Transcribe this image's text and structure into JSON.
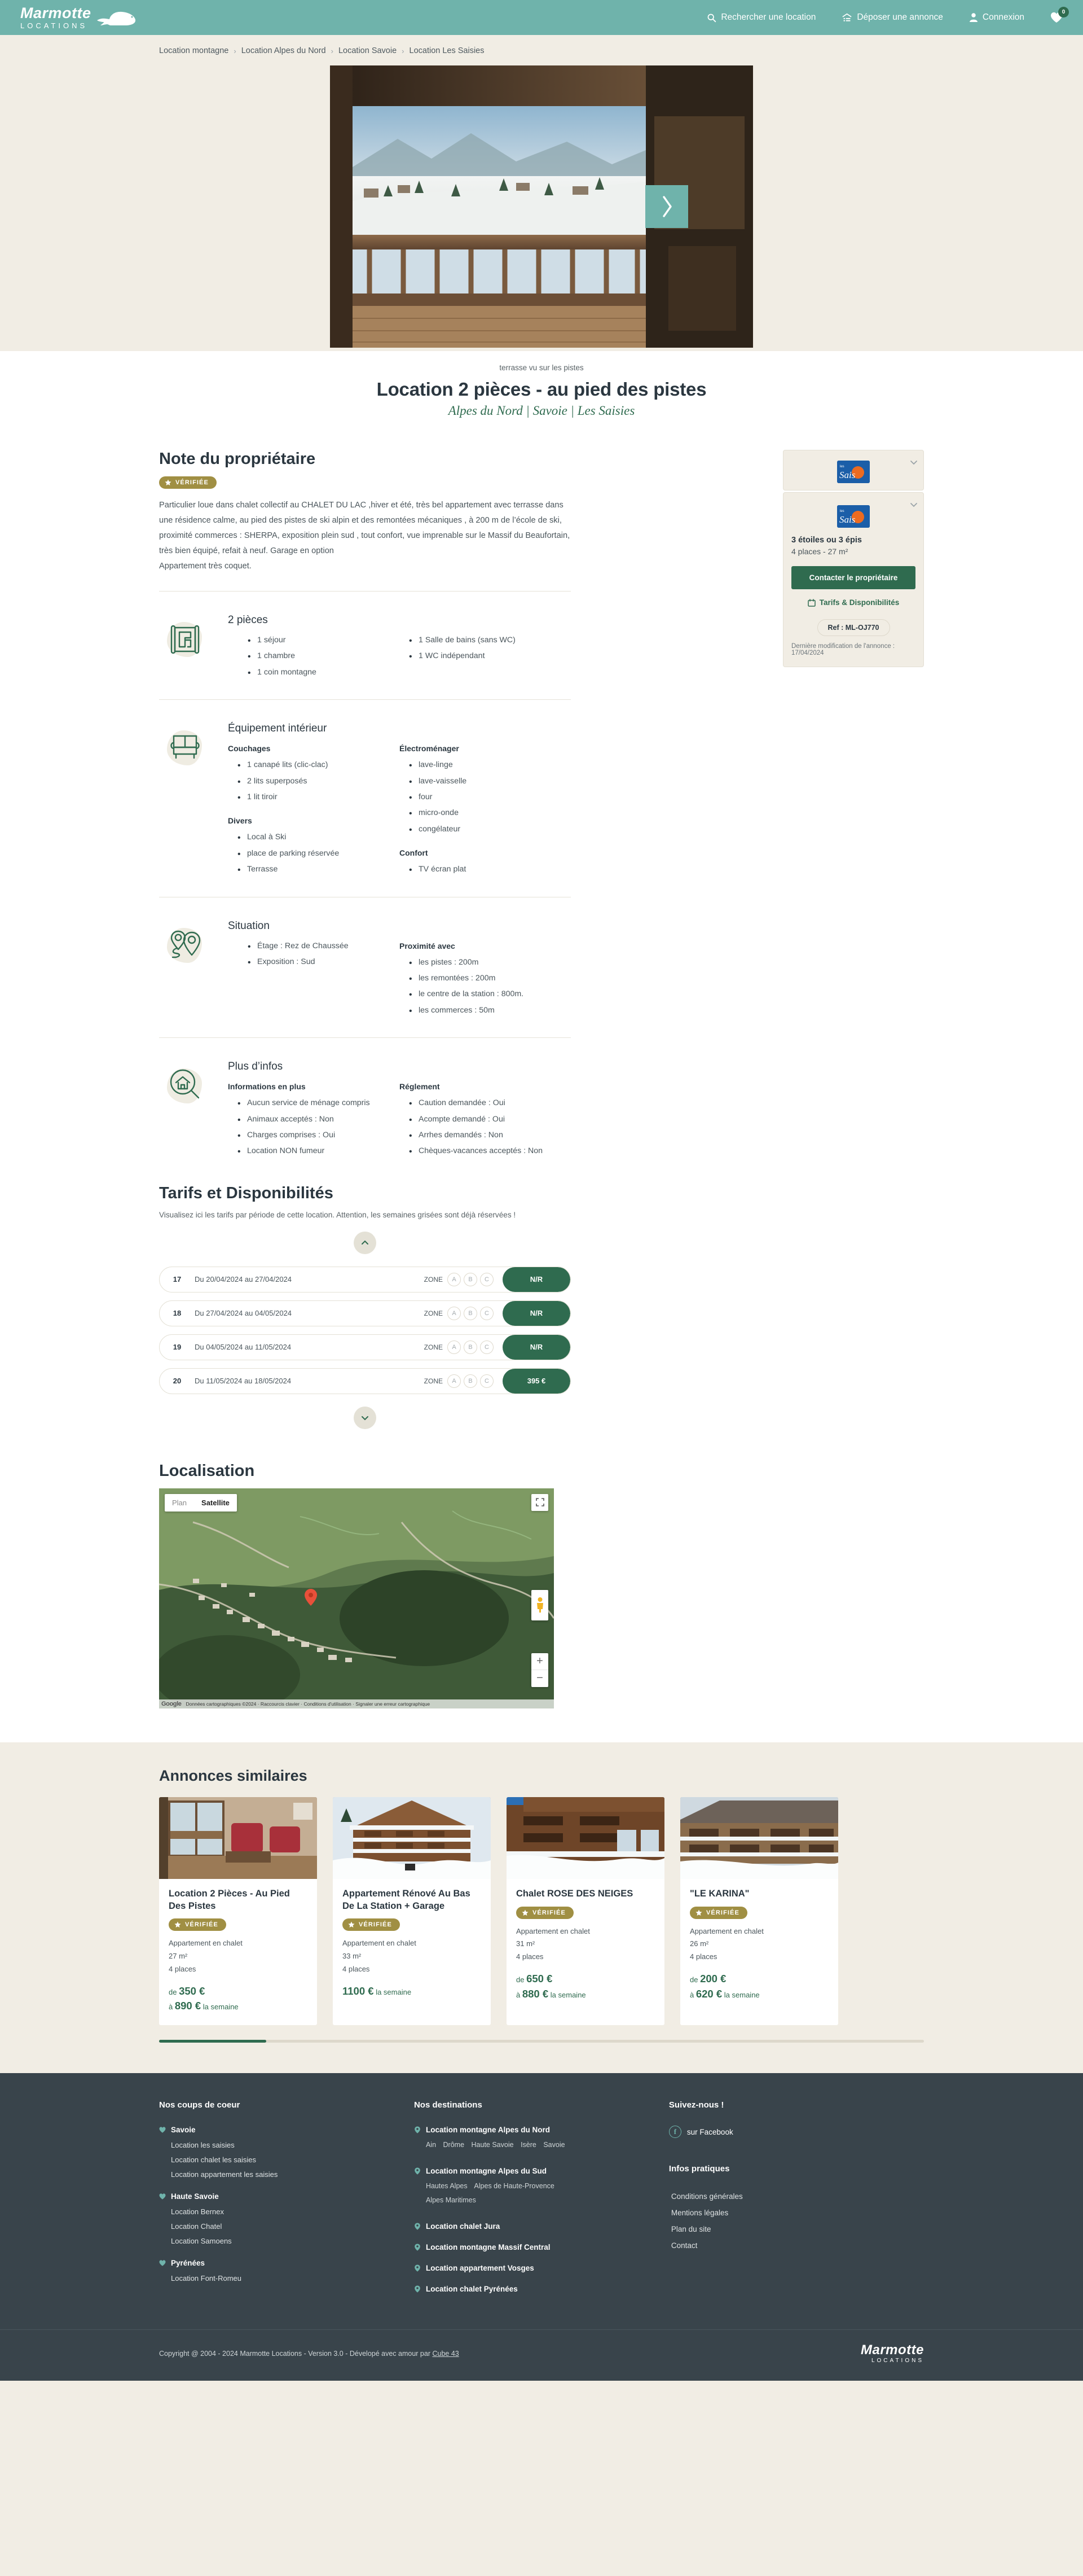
{
  "brand": {
    "name": "Marmotte",
    "sub": "LOCATIONS",
    "icon": "marmot-icon"
  },
  "header": {
    "nav": [
      {
        "label": "Rechercher une location",
        "icon": "search-icon"
      },
      {
        "label": "Déposer une annonce",
        "icon": "house-upload-icon"
      },
      {
        "label": "Connexion",
        "icon": "user-icon"
      }
    ],
    "favorites": {
      "icon": "heart-icon",
      "count": "0"
    }
  },
  "breadcrumb": [
    "Location montagne",
    "Location Alpes du Nord",
    "Location Savoie",
    "Location Les Saisies"
  ],
  "breadcrumb_separator": "›",
  "gallery": {
    "prev_icon": "chevron-left-icon",
    "next_icon": "chevron-right-icon",
    "caption": "terrasse vu sur les pistes"
  },
  "listing": {
    "title": "Location 2 pièces - au pied des pistes",
    "subtitle": "Alpes du Nord | Savoie | Les Saisies"
  },
  "note": {
    "heading": "Note du propriétaire",
    "badge": "VÉRIFIÉE",
    "badge_icon": "star-icon",
    "paragraphs": [
      "Particulier loue dans chalet collectif au CHALET DU LAC ,hiver et été, très bel appartement avec terrasse dans une résidence calme, au pied des pistes de ski alpin et des remontées mécaniques , à 200 m de l’école de ski, proximité commerces : SHERPA, exposition plein sud , tout confort, vue imprenable sur le Massif du Beaufortain, très bien équipé, refait à neuf. Garage en option",
      "Appartement très coquet."
    ]
  },
  "sections": [
    {
      "icon": "floorplan-icon",
      "heading": "2 pièces",
      "columns": [
        {
          "title": "",
          "items": [
            "1 séjour",
            "1 chambre",
            "1 coin montagne"
          ]
        },
        {
          "title": "",
          "items": [
            "1 Salle de bains (sans WC)",
            "1 WC indépendant"
          ]
        }
      ]
    },
    {
      "icon": "sofa-icon",
      "heading": "Équipement intérieur",
      "columns": [
        {
          "groups": [
            {
              "title": "Couchages",
              "items": [
                "1 canapé lits (clic-clac)",
                "2 lits superposés",
                "1 lit tiroir"
              ]
            },
            {
              "title": "Divers",
              "items": [
                "Local à Ski",
                "place de parking réservée",
                "Terrasse"
              ]
            }
          ]
        },
        {
          "groups": [
            {
              "title": "Électroménager",
              "items": [
                "lave-linge",
                "lave-vaisselle",
                "four",
                "micro-onde",
                "congélateur"
              ]
            },
            {
              "title": "Confort",
              "items": [
                "TV écran plat"
              ]
            }
          ]
        }
      ]
    },
    {
      "icon": "map-pins-icon",
      "heading": "Situation",
      "columns": [
        {
          "groups": [
            {
              "title": "",
              "items": [
                "Étage : Rez de Chaussée",
                "Exposition : Sud"
              ]
            }
          ]
        },
        {
          "groups": [
            {
              "title": "Proximité avec",
              "items": [
                "les pistes : 200m",
                "les remontées : 200m",
                "le centre de la station : 800m.",
                "les commerces : 50m"
              ]
            }
          ]
        }
      ]
    },
    {
      "icon": "house-search-icon",
      "heading": "Plus d’infos",
      "columns": [
        {
          "groups": [
            {
              "title": "Informations en plus",
              "items": [
                "Aucun service de ménage compris",
                "Animaux acceptés : Non",
                "Charges comprises : Oui",
                "Location NON fumeur"
              ]
            }
          ]
        },
        {
          "groups": [
            {
              "title": "Réglement",
              "items": [
                "Caution demandée : Oui",
                "Acompte demandé : Oui",
                "Arrhes demandés : Non",
                "Chèques-vacances acceptés : Non"
              ]
            }
          ]
        }
      ]
    }
  ],
  "sidecard": {
    "resort_logo_top": "les Saisies",
    "resort_logo_main": "les Saisies",
    "chevron_icon": "chevron-down-icon",
    "stars": "3 étoiles ou 3 épis",
    "capacity": "4 places - 27 m²",
    "contact_button": "Contacter le propriétaire",
    "tarifs_link": "Tarifs & Disponibilités",
    "tarifs_link_icon": "calendar-icon",
    "ref": "Ref : ML-OJ770",
    "last_modified": "Dernière modification de l'annonce : 17/04/2024"
  },
  "tarifs": {
    "heading": "Tarifs et Disponibilités",
    "intro": "Visualisez ici les tarifs par période de cette location. Attention, les semaines grisées sont déjà réservées !",
    "up_icon": "chevron-up-icon",
    "down_icon": "chevron-down-icon",
    "zone_label": "ZONE",
    "zones": [
      "A",
      "B",
      "C"
    ],
    "rows": [
      {
        "week": "17",
        "dates": "Du 20/04/2024 au 27/04/2024",
        "price": "N/R"
      },
      {
        "week": "18",
        "dates": "Du 27/04/2024 au 04/05/2024",
        "price": "N/R"
      },
      {
        "week": "19",
        "dates": "Du 04/05/2024 au 11/05/2024",
        "price": "N/R"
      },
      {
        "week": "20",
        "dates": "Du 11/05/2024 au 18/05/2024",
        "price": "395 €"
      }
    ]
  },
  "localisation": {
    "heading": "Localisation",
    "map_tab_plan": "Plan",
    "map_tab_satellite": "Satellite",
    "fullscreen_icon": "fullscreen-icon",
    "pegman_icon": "street-view-icon",
    "zoom_in": "+",
    "zoom_out": "−",
    "logo": "Google",
    "credit": "Données cartographiques ©2024 · Raccourcis clavier · Conditions d'utilisation · Signaler une erreur cartographique",
    "pin_icon": "map-marker-icon"
  },
  "similar": {
    "heading": "Annonces similaires",
    "badge": "VÉRIFIÉE",
    "cards": [
      {
        "title": "Location 2 Pièces - Au Pied Des Pistes",
        "verified": true,
        "type": "Appartement en chalet",
        "surface": "27 m²",
        "places": "4 places",
        "price_from_label": "de",
        "price_from": "350 €",
        "price_to_label": "à",
        "price_to": "890 €",
        "price_unit": "la semaine"
      },
      {
        "title": "Appartement Rénové Au Bas De La Station + Garage",
        "verified": true,
        "type": "Appartement en chalet",
        "surface": "33 m²",
        "places": "4 places",
        "price_from_label": "",
        "price_from": "1100 €",
        "price_to_label": "",
        "price_to": "",
        "price_unit": "la semaine"
      },
      {
        "title": "Chalet ROSE DES NEIGES",
        "verified": true,
        "type": "Appartement en chalet",
        "surface": "31 m²",
        "places": "4 places",
        "price_from_label": "de",
        "price_from": "650 €",
        "price_to_label": "à",
        "price_to": "880 €",
        "price_unit": "la semaine"
      },
      {
        "title": "\"LE KARINA\"",
        "verified": true,
        "type": "Appartement en chalet",
        "surface": "26 m²",
        "places": "4 places",
        "price_from_label": "de",
        "price_from": "200 €",
        "price_to_label": "à",
        "price_to": "620 €",
        "price_unit": "la semaine"
      }
    ]
  },
  "footer": {
    "col1": {
      "heading": "Nos coups de coeur",
      "groups": [
        {
          "icon": "heart-icon",
          "title": "Savoie",
          "links": [
            "Location les saisies",
            "Location chalet les saisies",
            "Location appartement les saisies"
          ]
        },
        {
          "icon": "heart-icon",
          "title": "Haute Savoie",
          "links": [
            "Location Bernex",
            "Location Chatel",
            "Location Samoens"
          ]
        },
        {
          "icon": "heart-icon",
          "title": "Pyrénées",
          "links": [
            "Location Font-Romeu"
          ]
        }
      ]
    },
    "col2": {
      "heading": "Nos destinations",
      "groups": [
        {
          "icon": "map-marker-icon",
          "title": "Location montagne Alpes du Nord",
          "sublinks": [
            "Ain",
            "Drôme",
            "Haute Savoie",
            "Isère",
            "Savoie"
          ]
        },
        {
          "icon": "map-marker-icon",
          "title": "Location montagne Alpes du Sud",
          "sublinks": [
            "Hautes Alpes",
            "Alpes de Haute-Provence",
            "Alpes Maritimes"
          ]
        },
        {
          "icon": "map-marker-icon",
          "title": "Location chalet Jura",
          "sublinks": []
        },
        {
          "icon": "map-marker-icon",
          "title": "Location montagne Massif Central",
          "sublinks": []
        },
        {
          "icon": "map-marker-icon",
          "title": "Location appartement Vosges",
          "sublinks": []
        },
        {
          "icon": "map-marker-icon",
          "title": "Location chalet Pyrénées",
          "sublinks": []
        }
      ]
    },
    "col3": {
      "heading": "Suivez-nous !",
      "social": {
        "icon": "facebook-icon",
        "label": "sur Facebook"
      },
      "practical_heading": "Infos pratiques",
      "practical_links": [
        "Conditions générales",
        "Mentions légales",
        "Plan du site",
        "Contact"
      ]
    },
    "copyright_prefix": "Copyright @ 2004 - 2024 Marmotte Locations - Version 3.0 - Dévelopé avec amour par ",
    "copyright_link": "Cube 43"
  },
  "colors": {
    "brand_teal": "#6fb3ab",
    "accent_green": "#2f6b4f",
    "badge_gold": "#a08f43",
    "page_bg": "#f1ede4",
    "footer_bg": "#39444b"
  }
}
